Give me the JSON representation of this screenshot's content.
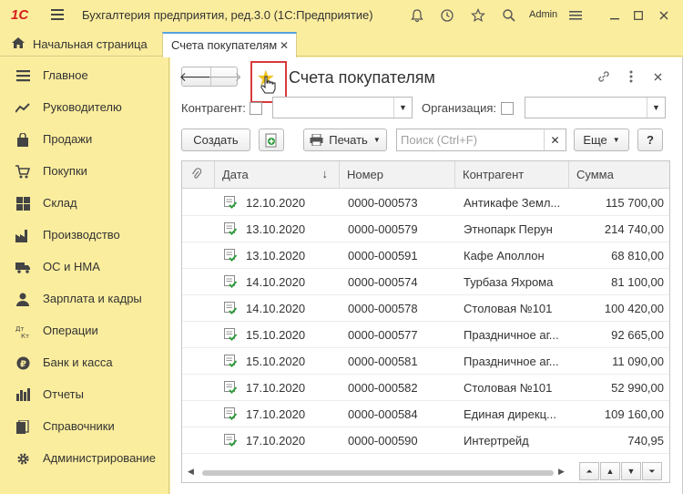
{
  "app": {
    "logo": "1С",
    "title": "Бухгалтерия предприятия, ред.3.0  (1С:Предприятие)",
    "user": "Admin"
  },
  "tabs": {
    "home": "Начальная страница",
    "active": "Счета покупателям"
  },
  "sidebar": {
    "items": [
      {
        "label": "Главное",
        "icon": "menu-lines-icon"
      },
      {
        "label": "Руководителю",
        "icon": "trend-icon"
      },
      {
        "label": "Продажи",
        "icon": "shopping-bag-icon"
      },
      {
        "label": "Покупки",
        "icon": "cart-icon"
      },
      {
        "label": "Склад",
        "icon": "warehouse-icon"
      },
      {
        "label": "Производство",
        "icon": "factory-icon"
      },
      {
        "label": "ОС и НМА",
        "icon": "truck-icon"
      },
      {
        "label": "Зарплата и кадры",
        "icon": "person-icon"
      },
      {
        "label": "Операции",
        "icon": "debit-credit-icon"
      },
      {
        "label": "Банк и касса",
        "icon": "ruble-coin-icon"
      },
      {
        "label": "Отчеты",
        "icon": "bar-chart-icon"
      },
      {
        "label": "Справочники",
        "icon": "books-icon"
      },
      {
        "label": "Администрирование",
        "icon": "gear-icon"
      }
    ]
  },
  "form": {
    "title": "Счета покупателям",
    "filter_counterparty_label": "Контрагент:",
    "filter_org_label": "Организация:",
    "create_label": "Создать",
    "print_label": "Печать",
    "search_placeholder": "Поиск (Ctrl+F)",
    "more_label": "Еще",
    "help_label": "?"
  },
  "table": {
    "columns": [
      "Дата",
      "Номер",
      "Контрагент",
      "Сумма"
    ],
    "rows": [
      {
        "date": "12.10.2020",
        "number": "0000-000573",
        "counterparty": "Антикафе Земл...",
        "sum": "115 700,00"
      },
      {
        "date": "13.10.2020",
        "number": "0000-000579",
        "counterparty": "Этнопарк Перун",
        "sum": "214 740,00"
      },
      {
        "date": "13.10.2020",
        "number": "0000-000591",
        "counterparty": "Кафе Аполлон",
        "sum": "68 810,00"
      },
      {
        "date": "14.10.2020",
        "number": "0000-000574",
        "counterparty": "Турбаза Яхрома",
        "sum": "81 100,00"
      },
      {
        "date": "14.10.2020",
        "number": "0000-000578",
        "counterparty": "Столовая №101",
        "sum": "100 420,00"
      },
      {
        "date": "15.10.2020",
        "number": "0000-000577",
        "counterparty": "Праздничное аг...",
        "sum": "92 665,00"
      },
      {
        "date": "15.10.2020",
        "number": "0000-000581",
        "counterparty": "Праздничное аг...",
        "sum": "11 090,00"
      },
      {
        "date": "17.10.2020",
        "number": "0000-000582",
        "counterparty": "Столовая №101",
        "sum": "52 990,00"
      },
      {
        "date": "17.10.2020",
        "number": "0000-000584",
        "counterparty": "Единая дирекц...",
        "sum": "109 160,00"
      },
      {
        "date": "17.10.2020",
        "number": "0000-000590",
        "counterparty": "Интертрейд",
        "sum": "740,95"
      }
    ]
  },
  "colors": {
    "panel_bg": "#fbed9e",
    "accent": "#53a3e0",
    "highlight": "#d83a3a",
    "star": "#f5c518",
    "doc_check": "#2e9c3a"
  }
}
